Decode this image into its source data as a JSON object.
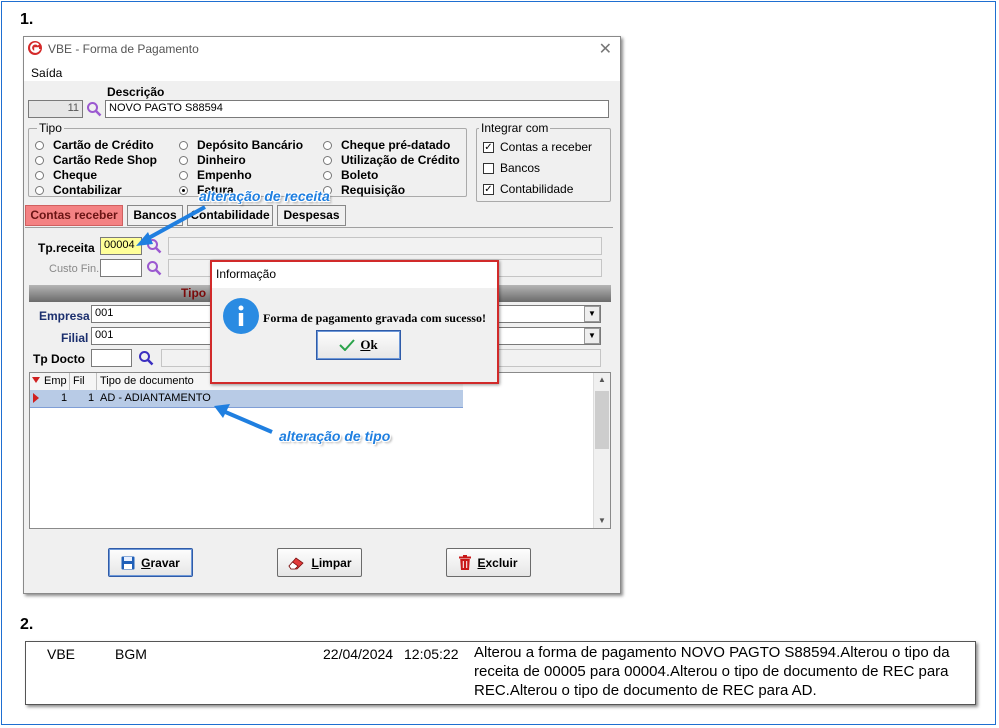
{
  "steps": {
    "one": "1.",
    "two": "2."
  },
  "window": {
    "title": "VBE - Forma de Pagamento",
    "colors": {
      "brand_logo": "#d42a2a",
      "active_tab": "#f48283",
      "annotation": "#1f7fe0",
      "selected_row": "#b8cbe6"
    }
  },
  "menu": {
    "saida": "Saída"
  },
  "descricao": {
    "label": "Descrição",
    "code": "11",
    "value": "NOVO PAGTO S88594"
  },
  "tipo": {
    "legend": "Tipo",
    "options": [
      {
        "label": "Cartão de Crédito",
        "selected": false
      },
      {
        "label": "Cartão Rede Shop",
        "selected": false
      },
      {
        "label": "Cheque",
        "selected": false
      },
      {
        "label": "Contabilizar",
        "selected": false
      },
      {
        "label": "Depósito Bancário",
        "selected": false
      },
      {
        "label": "Dinheiro",
        "selected": false
      },
      {
        "label": "Empenho",
        "selected": false
      },
      {
        "label": "Fatura",
        "selected": true
      },
      {
        "label": "Cheque pré-datado",
        "selected": false
      },
      {
        "label": "Utilização de Crédito",
        "selected": false
      },
      {
        "label": "Boleto",
        "selected": false
      },
      {
        "label": "Requisição",
        "selected": false
      }
    ]
  },
  "integrar": {
    "legend": "Integrar com",
    "items": [
      {
        "label": "Contas a receber",
        "checked": true
      },
      {
        "label": "Bancos",
        "checked": false
      },
      {
        "label": "Contabilidade",
        "checked": true
      }
    ]
  },
  "tabs": [
    {
      "label": "Contas receber",
      "active": true
    },
    {
      "label": "Bancos",
      "active": false
    },
    {
      "label": "Contabilidade",
      "active": false
    },
    {
      "label": "Despesas",
      "active": false
    }
  ],
  "contas": {
    "tp_receita_label": "Tp.receita",
    "tp_receita_value": "00004",
    "custo_fin_label": "Custo Fin.",
    "section_title": "Tipo",
    "empresa_label": "Empresa",
    "empresa_value": "001",
    "filial_label": "Filial",
    "filial_value": "001",
    "tp_docto_label": "Tp Docto"
  },
  "grid": {
    "columns": [
      "Emp",
      "Fil",
      "Tipo de documento"
    ],
    "rows": [
      {
        "emp": "1",
        "fil": "1",
        "tipo": "AD - ADIANTAMENTO"
      }
    ]
  },
  "buttons": {
    "gravar": "ravar",
    "gravar_key": "G",
    "limpar": "impar",
    "limpar_key": "L",
    "excluir": "xcluir",
    "excluir_key": "E"
  },
  "dialog": {
    "title": "Informação",
    "message": "Forma de pagamento gravada com sucesso!",
    "ok": "k",
    "ok_key": "O"
  },
  "annotations": {
    "receita": "alteração de receita",
    "tipo": "alteração de tipo"
  },
  "log": {
    "system": "VBE",
    "user": "BGM",
    "date": "22/04/2024",
    "time": "12:05:22",
    "description": "Alterou a forma de pagamento NOVO PAGTO S88594.Alterou o tipo da receita de 00005 para 00004.Alterou o tipo de documento de REC para REC.Alterou o tipo de documento de REC para AD."
  }
}
